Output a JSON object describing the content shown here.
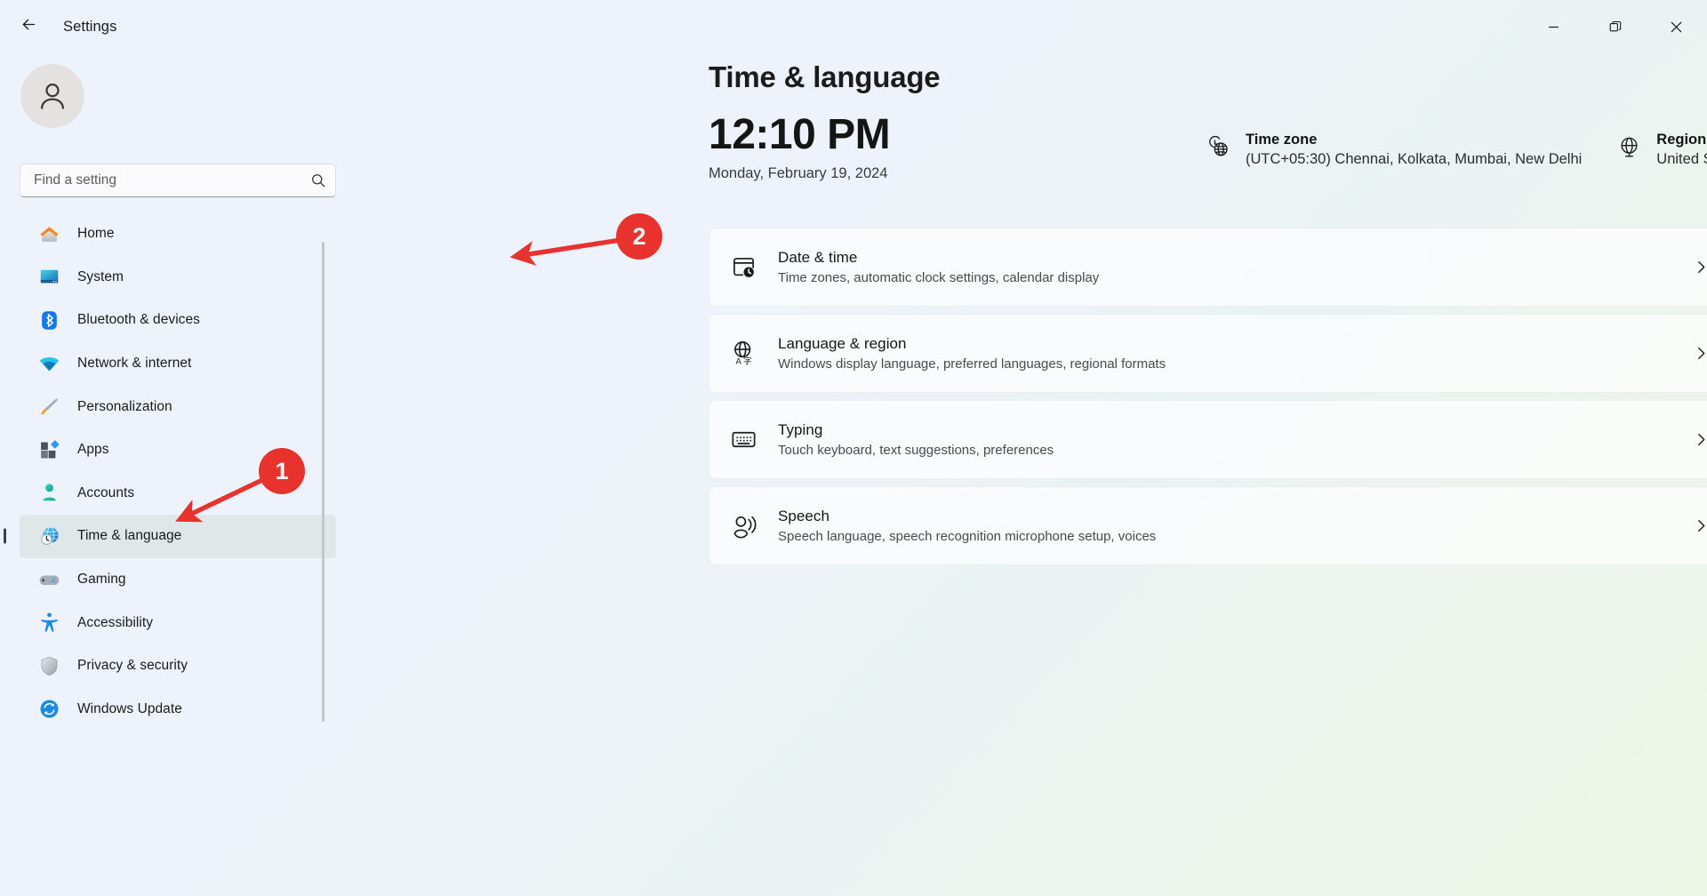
{
  "window": {
    "title": "Settings",
    "back_icon": "back-arrow-icon",
    "minimize_label": "Minimize",
    "restore_label": "Restore",
    "close_label": "Close"
  },
  "sidebar": {
    "avatar_icon": "user-avatar-icon",
    "search": {
      "placeholder": "Find a setting",
      "value": "",
      "icon": "search-icon"
    },
    "items": [
      {
        "label": "Home",
        "icon": "home-icon",
        "selected": false
      },
      {
        "label": "System",
        "icon": "system-monitor-icon",
        "selected": false
      },
      {
        "label": "Bluetooth & devices",
        "icon": "bluetooth-icon",
        "selected": false
      },
      {
        "label": "Network & internet",
        "icon": "wifi-icon",
        "selected": false
      },
      {
        "label": "Personalization",
        "icon": "paintbrush-icon",
        "selected": false
      },
      {
        "label": "Apps",
        "icon": "apps-grid-icon",
        "selected": false
      },
      {
        "label": "Accounts",
        "icon": "account-person-icon",
        "selected": false
      },
      {
        "label": "Time & language",
        "icon": "clock-globe-icon",
        "selected": true
      },
      {
        "label": "Gaming",
        "icon": "gamepad-icon",
        "selected": false
      },
      {
        "label": "Accessibility",
        "icon": "accessibility-person-icon",
        "selected": false
      },
      {
        "label": "Privacy & security",
        "icon": "shield-icon",
        "selected": false
      },
      {
        "label": "Windows Update",
        "icon": "refresh-circle-icon",
        "selected": false
      }
    ]
  },
  "main": {
    "page_title": "Time & language",
    "clock": {
      "time": "12:10 PM",
      "date": "Monday, February 19, 2024"
    },
    "time_zone": {
      "icon": "clock-globe-icon",
      "title": "Time zone",
      "value": "(UTC+05:30) Chennai, Kolkata, Mumbai, New Delhi"
    },
    "region": {
      "icon": "globe-icon",
      "title": "Region",
      "value": "United States"
    },
    "cards": [
      {
        "title": "Date & time",
        "subtitle": "Time zones, automatic clock settings, calendar display",
        "icon": "calendar-clock-icon",
        "chevron": "chevron-right-icon"
      },
      {
        "title": "Language & region",
        "subtitle": "Windows display language, preferred languages, regional formats",
        "icon": "language-globe-icon",
        "chevron": "chevron-right-icon"
      },
      {
        "title": "Typing",
        "subtitle": "Touch keyboard, text suggestions, preferences",
        "icon": "keyboard-icon",
        "chevron": "chevron-right-icon"
      },
      {
        "title": "Speech",
        "subtitle": "Speech language, speech recognition microphone setup, voices",
        "icon": "speech-icon",
        "chevron": "chevron-right-icon"
      }
    ]
  },
  "annotations": {
    "accent_color": "#e8322d",
    "markers": [
      {
        "label": "1",
        "points_to": "sidebar-item-time-language"
      },
      {
        "label": "2",
        "points_to": "card-date-time"
      }
    ]
  }
}
